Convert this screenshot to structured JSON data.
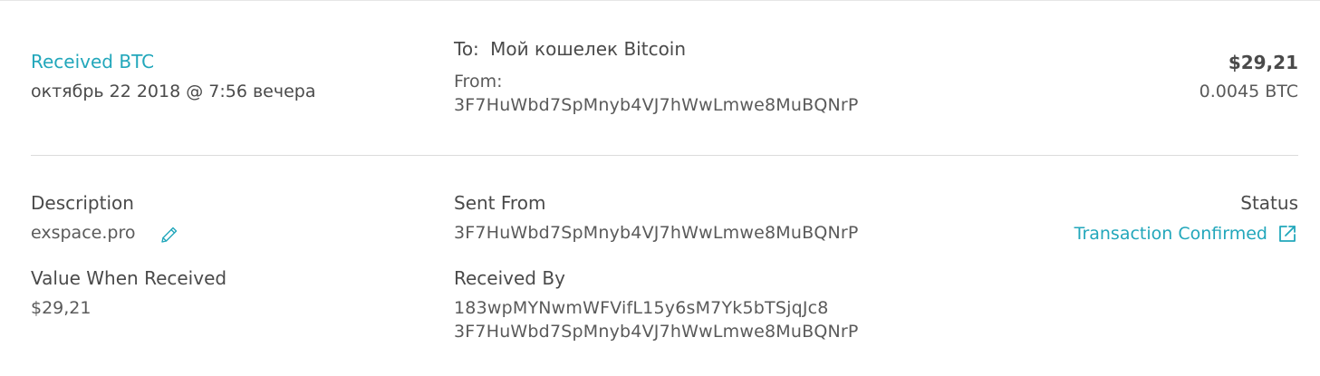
{
  "summary": {
    "title": "Received BTC",
    "date": "октябрь 22 2018 @ 7:56 вечера",
    "to_label": "To:",
    "to_wallet_prefix": "Мой кошелек",
    "to_wallet_name": "Bitcoin",
    "from_label": "From:",
    "from_address": "3F7HuWbd7SpMnyb4VJ7hWwLmwe8MuBQNrP",
    "usd_amount": "$29,21",
    "btc_amount": "0.0045 BTC"
  },
  "details": {
    "description_label": "Description",
    "description_value": "exspace.pro",
    "value_when_received_label": "Value When Received",
    "value_when_received": "$29,21",
    "sent_from_label": "Sent From",
    "sent_from_address": "3F7HuWbd7SpMnyb4VJ7hWwLmwe8MuBQNrP",
    "received_by_label": "Received By",
    "received_by_addresses": [
      "183wpMYNwmWFVifL15y6sM7Yk5bTSjqJc8",
      "3F7HuWbd7SpMnyb4VJ7hWwLmwe8MuBQNrP"
    ],
    "status_label": "Status",
    "status_value": "Transaction Confirmed"
  },
  "icons": {
    "edit": "pencil-icon",
    "status_link": "external-link-icon"
  },
  "colors": {
    "accent": "#22a7bb",
    "text": "#4a4a4a",
    "divider": "#dcdcdc"
  }
}
